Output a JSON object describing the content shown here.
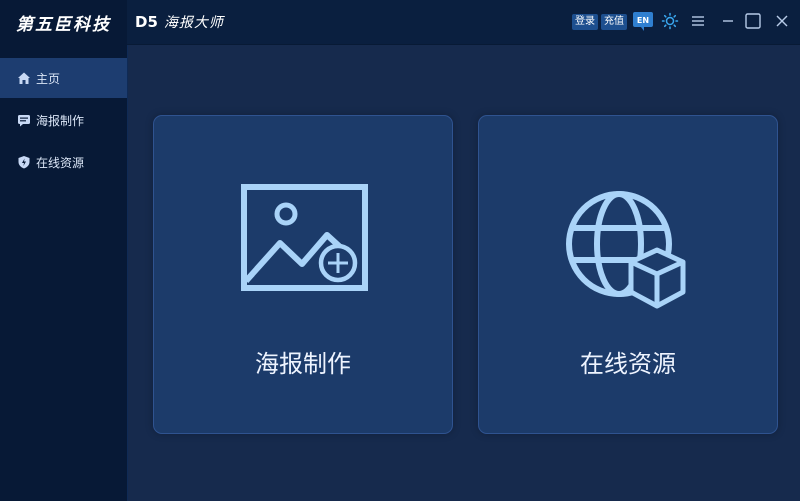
{
  "brand": {
    "logo_text": "第五臣科技"
  },
  "header": {
    "app_code": "D5",
    "app_name": "海报大师",
    "login_label": "登录",
    "recharge_label": "充值",
    "lang_label": "EN"
  },
  "sidebar": {
    "items": [
      {
        "label": "主页",
        "icon": "home-icon",
        "active": true
      },
      {
        "label": "海报制作",
        "icon": "message-icon",
        "active": false
      },
      {
        "label": "在线资源",
        "icon": "shield-icon",
        "active": false
      }
    ]
  },
  "main": {
    "cards": [
      {
        "label": "海报制作",
        "icon": "image-add-icon"
      },
      {
        "label": "在线资源",
        "icon": "globe-box-icon"
      }
    ]
  },
  "colors": {
    "sidebar_bg": "#071936",
    "main_bg": "#162a4d",
    "card_bg": "#1c3b6a",
    "icon_accent": "#a9d3f8"
  }
}
